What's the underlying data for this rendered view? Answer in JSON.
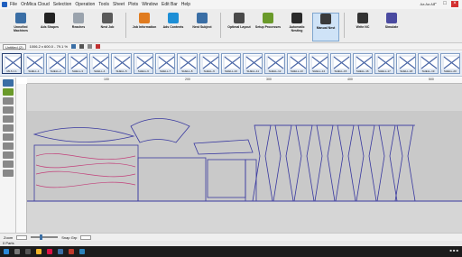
{
  "titlebar": {
    "menu": [
      "File",
      "OnMica Cloud",
      "Selection",
      "Operation",
      "Tools",
      "Sheet",
      "Plots",
      "Window",
      "Edit Bar",
      "Help"
    ],
    "right_text": "Aa Aa Aa"
  },
  "ribbon": {
    "buttons": [
      {
        "label": "Unnofied Machines",
        "icon": "machine-icon",
        "color": "#3a6ea5"
      },
      {
        "label": "Ads Shapes",
        "icon": "pointer-icon",
        "color": "#222222"
      },
      {
        "label": "Reaches",
        "icon": "doc-icon",
        "color": "#9aa3ad"
      },
      {
        "label": "Nest Job",
        "icon": "nest-icon",
        "color": "#5a5a5a"
      },
      {
        "label": "Job Information",
        "icon": "person-icon",
        "color": "#e07b1f"
      },
      {
        "label": "Ads Contents",
        "icon": "grid-icon",
        "color": "#1e8fd6"
      },
      {
        "label": "Nest Subject",
        "icon": "nest-subject-icon",
        "color": "#3a6ea5"
      },
      {
        "label": "Optimal Layout",
        "icon": "layout-icon",
        "color": "#4a4a4a"
      },
      {
        "label": "Setup Processes",
        "icon": "gear-icon",
        "color": "#6a9a2a"
      },
      {
        "label": "Automatic Nesting",
        "icon": "auto-nest-icon",
        "color": "#2a2a2a"
      },
      {
        "label": "Manual Nest",
        "icon": "manual-nest-icon",
        "color": "#3a3a3a"
      },
      {
        "label": "Write NC",
        "icon": "write-nc-icon",
        "color": "#333333"
      },
      {
        "label": "Simulate",
        "icon": "simulate-icon",
        "color": "#4a4aa0"
      }
    ]
  },
  "subbar": {
    "sheet_select": "Untitled (2)",
    "dims": "1006.2 x 600.0 - 79.1 %"
  },
  "thumbnails": [
    {
      "label": "MLS 1.1"
    },
    {
      "label": "SHELL-1"
    },
    {
      "label": "SHELL-2"
    },
    {
      "label": "SHELL-3"
    },
    {
      "label": "SHELL-4"
    },
    {
      "label": "SHELL-5"
    },
    {
      "label": "SHELL-6"
    },
    {
      "label": "SHELL-7"
    },
    {
      "label": "SHELL-8"
    },
    {
      "label": "SHELL-9"
    },
    {
      "label": "SHELL-10"
    },
    {
      "label": "SHELL-11"
    },
    {
      "label": "SHELL-12"
    },
    {
      "label": "SHELL-13"
    },
    {
      "label": "SHELL-14"
    },
    {
      "label": "SHELL-15"
    },
    {
      "label": "SHELL-16"
    },
    {
      "label": "SHELL-17"
    },
    {
      "label": "SHELL-18"
    },
    {
      "label": "SHELL-19"
    },
    {
      "label": "SHELL-20"
    }
  ],
  "ruler": {
    "ticks": [
      "100",
      "200",
      "300",
      "400",
      "500"
    ]
  },
  "bottombar": {
    "zoom_label": "Zoom",
    "snap_label": "Snap Grp"
  },
  "statusbar": {
    "text": "0 Parts"
  },
  "colors": {
    "sheet": "#c8c8c8",
    "part_outline": "#3a3aa0",
    "curve": "#c2407a"
  }
}
